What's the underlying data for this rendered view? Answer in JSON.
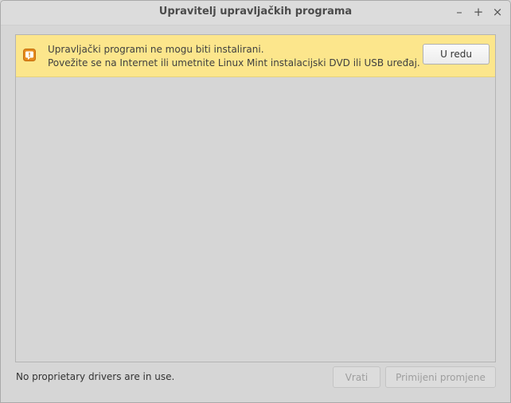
{
  "window": {
    "title": "Upravitelj upravljačkih programa",
    "controls": {
      "minimize": "–",
      "maximize": "+",
      "close": "×"
    }
  },
  "infobar": {
    "icon": "warning-icon",
    "line1": "Upravljački programi ne mogu biti instalirani.",
    "line2": "Povežite se na Internet ili umetnite Linux Mint instalacijski DVD ili USB uređaj.",
    "ok_label": "U redu",
    "background": "#fce68c"
  },
  "footer": {
    "status": "No proprietary drivers are in use.",
    "revert_label": "Vrati",
    "apply_label": "Primijeni promjene"
  }
}
